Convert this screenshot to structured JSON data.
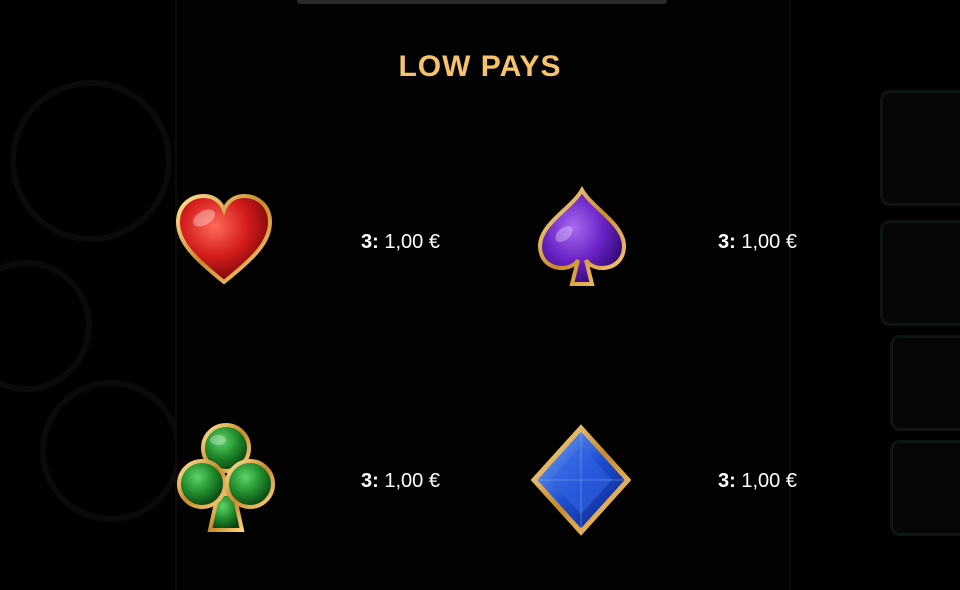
{
  "title": "LOW PAYS",
  "symbols": [
    {
      "name": "heart",
      "icon": "heart-icon",
      "color": "#d41c1c",
      "count": "3:",
      "value": "1,00 €"
    },
    {
      "name": "spade",
      "icon": "spade-icon",
      "color": "#6a22c4",
      "count": "3:",
      "value": "1,00 €"
    },
    {
      "name": "club",
      "icon": "club-icon",
      "color": "#1f8a2c",
      "count": "3:",
      "value": "1,00 €"
    },
    {
      "name": "diamond",
      "icon": "diamond-icon",
      "color": "#1f4fd0",
      "count": "3:",
      "value": "1,00 €"
    }
  ],
  "colors": {
    "title": "#f6c36a",
    "frame": "#d8a24a",
    "background": "#000000"
  }
}
